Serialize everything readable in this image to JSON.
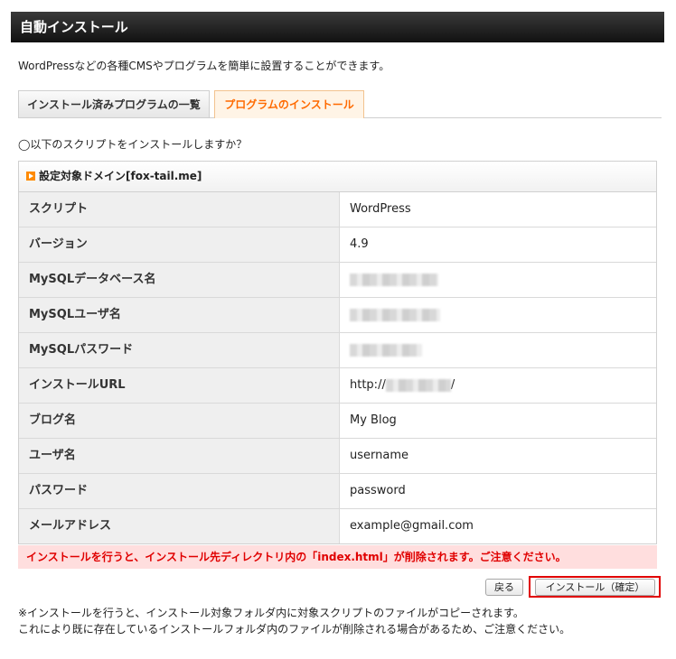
{
  "title": "自動インストール",
  "intro": "WordPressなどの各種CMSやプログラムを簡単に設置することができます。",
  "tabs": [
    {
      "label": "インストール済みプログラムの一覧"
    },
    {
      "label": "プログラムのインストール"
    }
  ],
  "question": "◯以下のスクリプトをインストールしますか？",
  "table": {
    "header": "設定対象ドメイン[fox-tail.me]",
    "rows": [
      {
        "label": "スクリプト",
        "value": "WordPress"
      },
      {
        "label": "バージョン",
        "value": "4.9"
      },
      {
        "label": "MySQLデータベース名",
        "value": ""
      },
      {
        "label": "MySQLユーザ名",
        "value": ""
      },
      {
        "label": "MySQLパスワード",
        "value": ""
      },
      {
        "label": "インストールURL",
        "prefix": "http://",
        "suffix": "/"
      },
      {
        "label": "ブログ名",
        "value": "My Blog"
      },
      {
        "label": "ユーザ名",
        "value": "username"
      },
      {
        "label": "パスワード",
        "value": "password"
      },
      {
        "label": "メールアドレス",
        "value": "example@gmail.com"
      }
    ]
  },
  "warning": "インストールを行うと、インストール先ディレクトリ内の「index.html」が削除されます。ご注意ください。",
  "buttons": {
    "back": "戻る",
    "install": "インストール（確定）"
  },
  "notes": [
    "※インストールを行うと、インストール対象フォルダ内に対象スクリプトのファイルがコピーされます。",
    "これにより既に存在しているインストールフォルダ内のファイルが削除される場合があるため、ご注意ください。"
  ],
  "colors": {
    "accent": "#ff6a00",
    "warning_bg": "#ffdede",
    "warning_text": "#e00000"
  }
}
